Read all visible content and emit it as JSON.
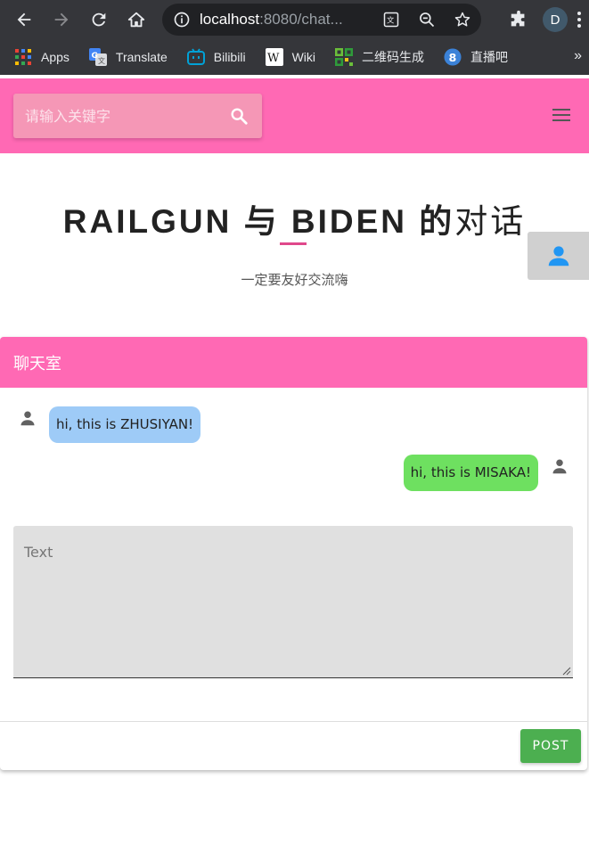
{
  "browser": {
    "url_host": "localhost",
    "url_path": ":8080/chat...",
    "profile_initial": "D",
    "bookmarks": [
      {
        "label": "Apps",
        "icon": "apps-grid-icon"
      },
      {
        "label": "Translate",
        "icon": "translate-icon"
      },
      {
        "label": "Bilibili",
        "icon": "bilibili-icon"
      },
      {
        "label": "Wiki",
        "icon": "wikipedia-icon"
      },
      {
        "label": "二维码生成",
        "icon": "qrcode-icon"
      },
      {
        "label": "直播吧",
        "icon": "zhibo8-icon"
      }
    ],
    "more_bookmarks": "»"
  },
  "header": {
    "search_placeholder": "请输入关键字",
    "bg_color": "#ff69b4"
  },
  "hero": {
    "title_bold": "RAILGUN 与 BIDEN 的",
    "title_light": "对话",
    "subtitle": "一定要友好交流嗨"
  },
  "chat": {
    "header": "聊天室",
    "messages": [
      {
        "side": "left",
        "text": "hi, this is ZHUSIYAN!",
        "color": "#9ecbf7"
      },
      {
        "side": "right",
        "text": "hi, this is MISAKA!",
        "color": "#6ee060"
      }
    ],
    "input_placeholder": "Text",
    "post_label": "POST"
  }
}
